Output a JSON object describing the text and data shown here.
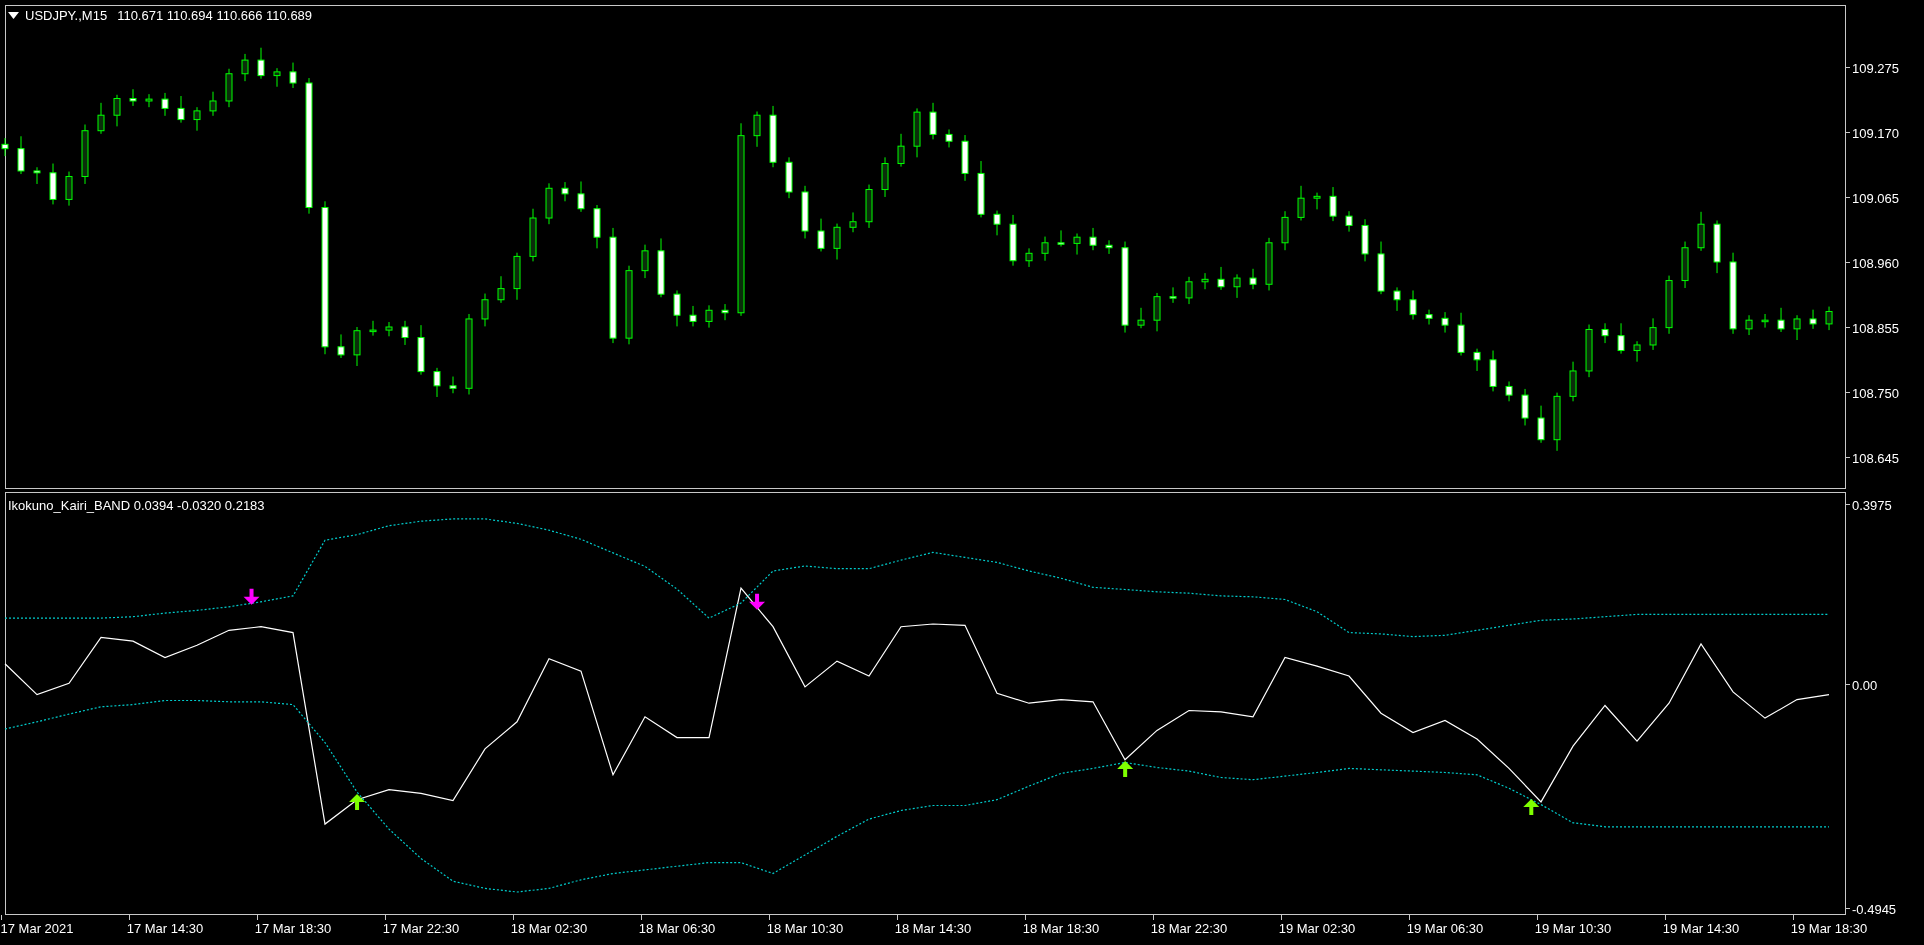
{
  "chart": {
    "symbol": "USDJPY.,M15",
    "ohlc": "110.671 110.694 110.666 110.689",
    "chart_data": {
      "type": "candlestick",
      "ylim": [
        108.595,
        109.375
      ],
      "categories": [
        null,
        null,
        null,
        null,
        null,
        null,
        null,
        null,
        null,
        null,
        null,
        null,
        null,
        null,
        null,
        null,
        null,
        null,
        null,
        null,
        null,
        null,
        null,
        null,
        null,
        null,
        null,
        null,
        null,
        null,
        null,
        null,
        null,
        null,
        null,
        null,
        null,
        null,
        null,
        null,
        null,
        null,
        null,
        null,
        null,
        null,
        null,
        null,
        null,
        null,
        null,
        null,
        null,
        null,
        null,
        null,
        null,
        null,
        null,
        null,
        null,
        null,
        null,
        null,
        null,
        null,
        null,
        null,
        null,
        null,
        null,
        null,
        null,
        null,
        null,
        null,
        null,
        null,
        null,
        null,
        null,
        null,
        null,
        null,
        null,
        null,
        null,
        null,
        null,
        null,
        null,
        null,
        null,
        null,
        null,
        null,
        null,
        null,
        null,
        null,
        null,
        null,
        null,
        null,
        null,
        null,
        null,
        null,
        null,
        null,
        null,
        null,
        null,
        null,
        null
      ],
      "ohlc": [
        [
          109.15,
          109.16,
          109.131,
          109.143
        ],
        [
          109.143,
          109.163,
          109.102,
          109.107
        ],
        [
          109.107,
          109.113,
          109.086,
          109.104
        ],
        [
          109.104,
          109.119,
          109.053,
          109.061
        ],
        [
          109.061,
          109.106,
          109.051,
          109.098
        ],
        [
          109.098,
          109.182,
          109.086,
          109.172
        ],
        [
          109.172,
          109.217,
          109.167,
          109.197
        ],
        [
          109.197,
          109.23,
          109.179,
          109.224
        ],
        [
          109.224,
          109.239,
          109.212,
          109.22
        ],
        [
          109.22,
          109.231,
          109.21,
          109.223
        ],
        [
          109.223,
          109.233,
          109.196,
          109.208
        ],
        [
          109.208,
          109.228,
          109.185,
          109.19
        ],
        [
          109.19,
          109.21,
          109.172,
          109.204
        ],
        [
          109.204,
          109.235,
          109.196,
          109.22
        ],
        [
          109.22,
          109.272,
          109.21,
          109.264
        ],
        [
          109.264,
          109.296,
          109.252,
          109.286
        ],
        [
          109.286,
          109.306,
          109.256,
          109.261
        ],
        [
          109.261,
          109.273,
          109.243,
          109.267
        ],
        [
          109.267,
          109.282,
          109.241,
          109.249
        ],
        [
          109.249,
          109.257,
          109.038,
          109.048
        ],
        [
          109.048,
          109.058,
          108.811,
          108.823
        ],
        [
          108.823,
          108.843,
          108.805,
          108.81
        ],
        [
          108.81,
          108.855,
          108.792,
          108.849
        ],
        [
          108.849,
          108.865,
          108.841,
          108.85
        ],
        [
          108.85,
          108.863,
          108.84,
          108.855
        ],
        [
          108.855,
          108.865,
          108.826,
          108.838
        ],
        [
          108.838,
          108.858,
          108.778,
          108.783
        ],
        [
          108.783,
          108.789,
          108.742,
          108.76
        ],
        [
          108.76,
          108.775,
          108.748,
          108.756
        ],
        [
          108.756,
          108.876,
          108.746,
          108.868
        ],
        [
          108.868,
          108.909,
          108.856,
          108.899
        ],
        [
          108.899,
          108.937,
          108.894,
          108.917
        ],
        [
          108.917,
          108.975,
          108.899,
          108.969
        ],
        [
          108.969,
          109.046,
          108.961,
          109.031
        ],
        [
          109.031,
          109.087,
          109.021,
          109.079
        ],
        [
          109.079,
          109.089,
          109.058,
          109.07
        ],
        [
          109.07,
          109.09,
          109.041,
          109.046
        ],
        [
          109.046,
          109.052,
          108.982,
          109.0
        ],
        [
          109.0,
          109.015,
          108.829,
          108.837
        ],
        [
          108.837,
          108.954,
          108.827,
          108.946
        ],
        [
          108.946,
          108.988,
          108.934,
          108.978
        ],
        [
          108.978,
          108.998,
          108.903,
          108.908
        ],
        [
          108.908,
          108.914,
          108.856,
          108.874
        ],
        [
          108.874,
          108.889,
          108.856,
          108.864
        ],
        [
          108.864,
          108.89,
          108.854,
          108.882
        ],
        [
          108.882,
          108.892,
          108.866,
          108.878
        ],
        [
          108.878,
          109.184,
          108.873,
          109.164
        ],
        [
          109.164,
          109.203,
          109.146,
          109.197
        ],
        [
          109.197,
          109.212,
          109.113,
          109.121
        ],
        [
          109.121,
          109.129,
          109.063,
          109.073
        ],
        [
          109.073,
          109.083,
          108.998,
          109.01
        ],
        [
          109.01,
          109.03,
          108.977,
          108.982
        ],
        [
          108.982,
          109.022,
          108.964,
          109.016
        ],
        [
          109.016,
          109.04,
          109.008,
          109.025
        ],
        [
          109.025,
          109.085,
          109.015,
          109.077
        ],
        [
          109.077,
          109.129,
          109.065,
          109.119
        ],
        [
          109.119,
          109.167,
          109.114,
          109.147
        ],
        [
          109.147,
          109.208,
          109.129,
          109.202
        ],
        [
          109.202,
          109.217,
          109.158,
          109.166
        ],
        [
          109.166,
          109.174,
          109.145,
          109.155
        ],
        [
          109.155,
          109.165,
          109.091,
          109.103
        ],
        [
          109.103,
          109.123,
          109.032,
          109.037
        ],
        [
          109.037,
          109.043,
          109.003,
          109.021
        ],
        [
          109.021,
          109.036,
          108.954,
          108.962
        ],
        [
          108.962,
          108.982,
          108.952,
          108.974
        ],
        [
          108.974,
          109.001,
          108.962,
          108.991
        ],
        [
          108.991,
          109.011,
          108.985,
          108.99
        ],
        [
          108.99,
          109.006,
          108.972,
          109.0
        ],
        [
          109.0,
          109.015,
          108.979,
          108.987
        ],
        [
          108.987,
          108.995,
          108.973,
          108.983
        ],
        [
          108.983,
          108.993,
          108.846,
          108.858
        ],
        [
          108.858,
          108.886,
          108.853,
          108.866
        ],
        [
          108.866,
          108.91,
          108.848,
          108.904
        ],
        [
          108.904,
          108.919,
          108.894,
          108.902
        ],
        [
          108.902,
          108.936,
          108.892,
          108.928
        ],
        [
          108.928,
          108.942,
          108.916,
          108.932
        ],
        [
          108.932,
          108.952,
          108.915,
          108.92
        ],
        [
          108.92,
          108.94,
          108.902,
          108.934
        ],
        [
          108.934,
          108.949,
          108.916,
          108.924
        ],
        [
          108.924,
          108.999,
          108.914,
          108.991
        ],
        [
          108.991,
          109.042,
          108.979,
          109.032
        ],
        [
          109.032,
          109.083,
          109.027,
          109.063
        ],
        [
          109.063,
          109.072,
          109.045,
          109.066
        ],
        [
          109.066,
          109.081,
          109.026,
          109.034
        ],
        [
          109.034,
          109.042,
          109.009,
          109.019
        ],
        [
          109.019,
          109.029,
          108.961,
          108.973
        ],
        [
          108.973,
          108.993,
          108.908,
          108.913
        ],
        [
          108.913,
          108.919,
          108.881,
          108.899
        ],
        [
          108.899,
          108.914,
          108.867,
          108.875
        ],
        [
          108.875,
          108.883,
          108.859,
          108.869
        ],
        [
          108.869,
          108.879,
          108.846,
          108.858
        ],
        [
          108.858,
          108.878,
          108.809,
          108.814
        ],
        [
          108.814,
          108.82,
          108.784,
          108.802
        ],
        [
          108.802,
          108.817,
          108.751,
          108.759
        ],
        [
          108.759,
          108.767,
          108.735,
          108.745
        ],
        [
          108.745,
          108.755,
          108.696,
          108.708
        ],
        [
          108.708,
          108.728,
          108.668,
          108.673
        ],
        [
          108.673,
          108.749,
          108.655,
          108.743
        ],
        [
          108.743,
          108.799,
          108.735,
          108.784
        ],
        [
          108.784,
          108.859,
          108.774,
          108.851
        ],
        [
          108.851,
          108.861,
          108.829,
          108.841
        ],
        [
          108.841,
          108.861,
          108.812,
          108.817
        ],
        [
          108.817,
          108.832,
          108.799,
          108.826
        ],
        [
          108.826,
          108.869,
          108.818,
          108.854
        ],
        [
          108.854,
          108.938,
          108.844,
          108.93
        ],
        [
          108.93,
          108.993,
          108.918,
          108.983
        ],
        [
          108.983,
          109.041,
          108.978,
          109.021
        ],
        [
          109.021,
          109.027,
          108.942,
          108.96
        ],
        [
          108.96,
          108.975,
          108.844,
          108.852
        ],
        [
          108.852,
          108.874,
          108.842,
          108.866
        ],
        [
          108.866,
          108.876,
          108.854,
          108.866
        ],
        [
          108.866,
          108.886,
          108.847,
          108.852
        ],
        [
          108.852,
          108.874,
          108.834,
          108.868
        ],
        [
          108.868,
          108.883,
          108.852,
          108.86
        ],
        [
          108.86,
          108.888,
          108.85,
          108.88
        ]
      ],
      "yticks": [
        {
          "value": 109.275,
          "label": "109.275"
        },
        {
          "value": 109.17,
          "label": "109.170"
        },
        {
          "value": 109.065,
          "label": "109.065"
        },
        {
          "value": 108.96,
          "label": "108.960"
        },
        {
          "value": 108.855,
          "label": "108.855"
        },
        {
          "value": 108.75,
          "label": "108.750"
        },
        {
          "value": 108.645,
          "label": "108.645"
        }
      ]
    }
  },
  "indicator": {
    "chart_data": {
      "type": "line",
      "title": "Ikokuno_Kairi_BAND 0.0394 -0.0320 0.2183",
      "categories": [
        null,
        "17 Mar 2021",
        null,
        null,
        null,
        "17 Mar 14:30",
        null,
        null,
        null,
        "17 Mar 18:30",
        null,
        null,
        null,
        "17 Mar 22:30",
        null,
        null,
        null,
        "18 Mar 02:30",
        null,
        null,
        null,
        "18 Mar 06:30",
        null,
        null,
        null,
        "18 Mar 10:30",
        null,
        null,
        null,
        "18 Mar 14:30",
        null,
        null,
        null,
        "18 Mar 18:30",
        null,
        null,
        null,
        "18 Mar 22:30",
        null,
        null,
        null,
        "19 Mar 02:30",
        null,
        null,
        null,
        "19 Mar 06:30",
        null,
        null,
        null,
        "19 Mar 10:30",
        null,
        null,
        null,
        "19 Mar 14:30",
        null,
        null,
        null,
        "19 Mar 18:30"
      ],
      "series": [
        {
          "color": "#ffffff",
          "values": [
            0.045,
            -0.023,
            0.002,
            0.103,
            0.095,
            0.059,
            0.086,
            0.119,
            0.127,
            0.114,
            -0.309,
            -0.255,
            -0.233,
            -0.241,
            -0.257,
            -0.143,
            -0.083,
            0.056,
            0.029,
            -0.2,
            -0.072,
            -0.118,
            -0.118,
            0.212,
            0.127,
            -0.006,
            0.051,
            0.018,
            0.127,
            0.133,
            0.13,
            -0.02,
            -0.042,
            -0.034,
            -0.039,
            -0.167,
            -0.102,
            -0.058,
            -0.061,
            -0.072,
            0.059,
            0.04,
            0.018,
            -0.064,
            -0.107,
            -0.08,
            -0.121,
            -0.186,
            -0.26,
            -0.137,
            -0.047,
            -0.126,
            -0.042,
            0.089,
            -0.017,
            -0.075,
            -0.034,
            -0.023
          ]
        },
        {
          "color": "#00cccc",
          "line_style": "dashed",
          "values": [
            0.146,
            0.146,
            0.146,
            0.146,
            0.149,
            0.157,
            0.163,
            0.171,
            0.182,
            0.195,
            0.318,
            0.33,
            0.35,
            0.36,
            0.365,
            0.365,
            0.355,
            0.34,
            0.32,
            0.29,
            0.26,
            0.21,
            0.146,
            0.179,
            0.25,
            0.261,
            0.255,
            0.255,
            0.274,
            0.291,
            0.28,
            0.269,
            0.25,
            0.234,
            0.214,
            0.209,
            0.204,
            0.201,
            0.195,
            0.193,
            0.187,
            0.16,
            0.114,
            0.111,
            0.105,
            0.108,
            0.119,
            0.13,
            0.141,
            0.144,
            0.149,
            0.154,
            0.154,
            0.154,
            0.154,
            0.154,
            0.154,
            0.154
          ]
        },
        {
          "color": "#00cccc",
          "line_style": "dashed",
          "values": [
            -0.099,
            -0.083,
            -0.066,
            -0.05,
            -0.045,
            -0.036,
            -0.036,
            -0.039,
            -0.039,
            -0.045,
            -0.129,
            -0.238,
            -0.32,
            -0.385,
            -0.435,
            -0.451,
            -0.459,
            -0.451,
            -0.432,
            -0.418,
            -0.41,
            -0.402,
            -0.394,
            -0.394,
            -0.418,
            -0.377,
            -0.336,
            -0.298,
            -0.279,
            -0.268,
            -0.268,
            -0.255,
            -0.225,
            -0.197,
            -0.186,
            -0.173,
            -0.184,
            -0.192,
            -0.206,
            -0.211,
            -0.203,
            -0.195,
            -0.186,
            -0.189,
            -0.192,
            -0.195,
            -0.2,
            -0.23,
            -0.266,
            -0.306,
            -0.315,
            -0.315,
            -0.315,
            -0.315,
            -0.315,
            -0.315,
            -0.315,
            -0.315
          ]
        }
      ],
      "ylim": [
        -0.5097,
        0.4244
      ],
      "yticks": [
        {
          "value": 0.3975,
          "label": "0.3975"
        },
        {
          "value": 0,
          "label": "0.00"
        },
        {
          "value": -0.4945,
          "label": "-0.4945"
        }
      ]
    }
  }
}
